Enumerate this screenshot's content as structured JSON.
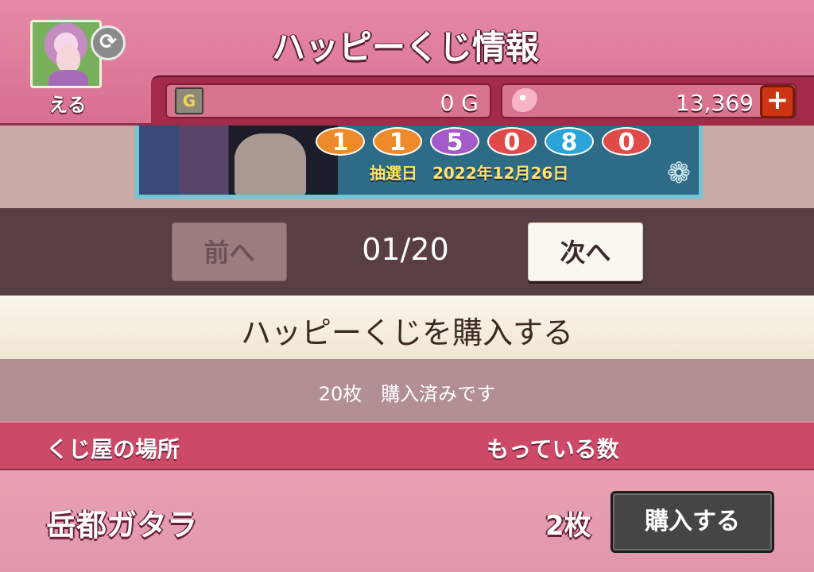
{
  "header": {
    "title": "ハッピーくじ情報",
    "player_name": "える",
    "swap_icon": "refresh-icon"
  },
  "currency": {
    "gold_icon_letter": "G",
    "gold_value": "0 G",
    "gem_value": "13,369",
    "add_label": "+"
  },
  "banner": {
    "numbers": [
      {
        "value": "1",
        "color": "#ee8a2a"
      },
      {
        "value": "1",
        "color": "#ee8a2a"
      },
      {
        "value": "5",
        "color": "#a35bc9"
      },
      {
        "value": "0",
        "color": "#e04a48"
      },
      {
        "value": "8",
        "color": "#2aa3d8"
      },
      {
        "value": "0",
        "color": "#e04a48"
      }
    ],
    "draw_date_label": "抽選日",
    "draw_date": "2022年12月26日"
  },
  "pager": {
    "prev_label": "前へ",
    "next_label": "次へ",
    "page_indicator": "01/20"
  },
  "purchase": {
    "heading": "ハッピーくじを購入する",
    "status": "20枚　購入済みです"
  },
  "table": {
    "columns": [
      "くじ屋の場所",
      "もっている数"
    ],
    "rows": [
      {
        "location": "岳都ガタラ",
        "count": "2枚",
        "action_label": "購入する"
      }
    ]
  }
}
